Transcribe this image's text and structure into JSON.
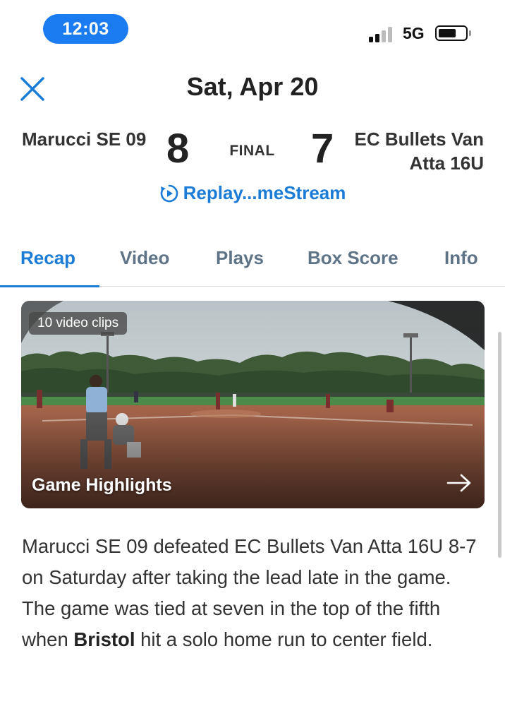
{
  "status_bar": {
    "time": "12:03",
    "network": "5G",
    "signal_bars_active": 2,
    "signal_bars_total": 4,
    "battery_level": 0.55
  },
  "header": {
    "title": "Sat, Apr 20",
    "close_icon": "close-icon"
  },
  "scoreboard": {
    "home_team": "Marucci SE 09",
    "home_score": "8",
    "status": "FINAL",
    "away_team": "EC Bullets Van Atta 16U",
    "away_score": "7",
    "replay_label": "Replay...meStream",
    "replay_icon": "replay-icon"
  },
  "tabs": [
    {
      "label": "Recap",
      "active": true
    },
    {
      "label": "Video",
      "active": false
    },
    {
      "label": "Plays",
      "active": false
    },
    {
      "label": "Box Score",
      "active": false
    },
    {
      "label": "Info",
      "active": false
    }
  ],
  "video_card": {
    "badge": "10 video clips",
    "title": "Game Highlights",
    "arrow_icon": "arrow-right-icon"
  },
  "recap": {
    "text_before": "Marucci SE 09 defeated EC Bullets Van Atta 16U 8-7 on Saturday after taking the lead late in the game. The game was tied at seven in the top of the fifth when ",
    "player": "Bristol",
    "text_after": " hit a solo home run to center field."
  },
  "colors": {
    "accent": "#1a7cd6",
    "time_pill": "#1a7cf0",
    "tab_inactive": "#5e7486"
  }
}
